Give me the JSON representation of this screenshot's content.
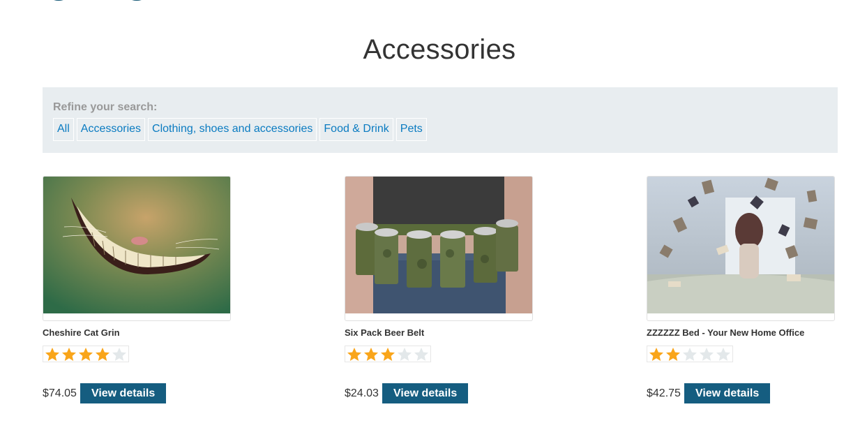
{
  "header": {
    "logo_icon": "brand-logo-icon"
  },
  "page": {
    "title": "Accessories"
  },
  "filter": {
    "label": "Refine your search:",
    "links": [
      "All",
      "Accessories",
      "Clothing, shoes and accessories",
      "Food & Drink",
      "Pets"
    ]
  },
  "products": [
    {
      "name": "Cheshire Cat Grin",
      "rating": 4,
      "max_rating": 5,
      "price": "$74.05",
      "button_label": "View details",
      "image_icon": "cheshire-grin-image"
    },
    {
      "name": "Six Pack Beer Belt",
      "rating": 3,
      "max_rating": 5,
      "price": "$24.03",
      "button_label": "View details",
      "image_icon": "beer-belt-image"
    },
    {
      "name": "ZZZZZZ Bed - Your New Home Office",
      "rating": 2,
      "max_rating": 5,
      "price": "$42.75",
      "button_label": "View details",
      "image_icon": "bed-books-image"
    }
  ],
  "colors": {
    "star_filled": "#f9a51a",
    "star_empty": "#e3e8ea",
    "button_bg": "#155d80",
    "link": "#0a7bc1",
    "panel_bg": "#e8edf0"
  }
}
